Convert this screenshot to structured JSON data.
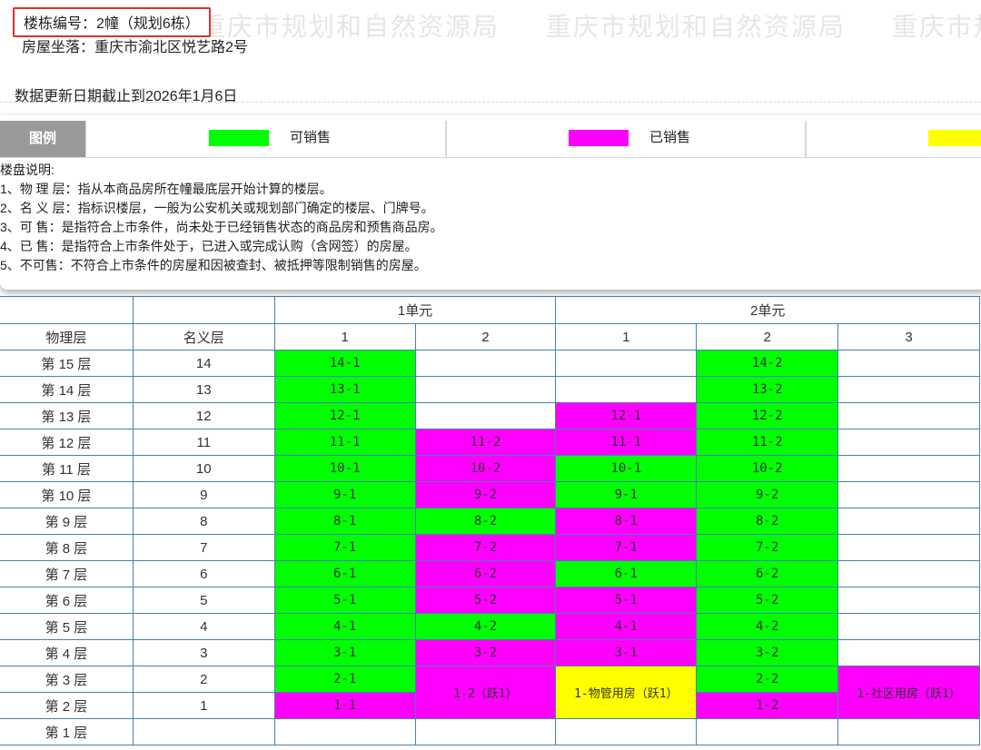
{
  "watermark": [
    "重庆市规划和自然资源局",
    "重庆市规划和自然资源局",
    "重庆市规划和自然资源局"
  ],
  "header": {
    "building_label": "楼栋编号：2幢（规划6栋）",
    "address_label": "房屋坐落：重庆市渝北区悦艺路2号",
    "update_text": "数据更新日期截止到2026年1月6日"
  },
  "legend": {
    "title": "图例",
    "items": [
      {
        "label": "可销售",
        "color": "#00ff00"
      },
      {
        "label": "已销售",
        "color": "#ff00ff"
      },
      {
        "label": "",
        "color": "#ffff00"
      }
    ]
  },
  "notes": {
    "heading": "楼盘说明:",
    "items": [
      "1、物 理 层：指从本商品房所在幢最底层开始计算的楼层。",
      "2、名 义 层：指标识楼层，一般为公安机关或规划部门确定的楼层、门牌号。",
      "3、可 售：是指符合上市条件，尚未处于已经销售状态的商品房和预售商品房。",
      "4、已 售：是指符合上市条件处于，已进入或完成认购（含网签）的房屋。",
      "5、不可售：不符合上市条件的房屋和因被查封、被抵押等限制销售的房屋。"
    ]
  },
  "table": {
    "units": [
      "1单元",
      "2单元"
    ],
    "col_physical": "物理层",
    "col_nominal": "名义层",
    "room_cols": [
      "1",
      "2",
      "1",
      "2",
      "3"
    ],
    "rows": [
      {
        "physical": "第 15 层",
        "nominal": "14",
        "c1": "14-1",
        "c2": "",
        "c3": "",
        "c4": "14-2",
        "c5": ""
      },
      {
        "physical": "第 14 层",
        "nominal": "13",
        "c1": "13-1",
        "c2": "",
        "c3": "",
        "c4": "13-2",
        "c5": ""
      },
      {
        "physical": "第 13 层",
        "nominal": "12",
        "c1": "12-1",
        "c2": "",
        "c3": "12-1",
        "c4": "12-2",
        "c5": ""
      },
      {
        "physical": "第 12 层",
        "nominal": "11",
        "c1": "11-1",
        "c2": "11-2",
        "c3": "11-1",
        "c4": "11-2",
        "c5": ""
      },
      {
        "physical": "第 11 层",
        "nominal": "10",
        "c1": "10-1",
        "c2": "10-2",
        "c3": "10-1",
        "c4": "10-2",
        "c5": ""
      },
      {
        "physical": "第 10 层",
        "nominal": "9",
        "c1": "9-1",
        "c2": "9-2",
        "c3": "9-1",
        "c4": "9-2",
        "c5": ""
      },
      {
        "physical": "第 9 层",
        "nominal": "8",
        "c1": "8-1",
        "c2": "8-2",
        "c3": "8-1",
        "c4": "8-2",
        "c5": ""
      },
      {
        "physical": "第 8 层",
        "nominal": "7",
        "c1": "7-1",
        "c2": "7-2",
        "c3": "7-1",
        "c4": "7-2",
        "c5": ""
      },
      {
        "physical": "第 7 层",
        "nominal": "6",
        "c1": "6-1",
        "c2": "6-2",
        "c3": "6-1",
        "c4": "6-2",
        "c5": ""
      },
      {
        "physical": "第 6 层",
        "nominal": "5",
        "c1": "5-1",
        "c2": "5-2",
        "c3": "5-1",
        "c4": "5-2",
        "c5": ""
      },
      {
        "physical": "第 5 层",
        "nominal": "4",
        "c1": "4-1",
        "c2": "4-2",
        "c3": "4-1",
        "c4": "4-2",
        "c5": ""
      },
      {
        "physical": "第 4 层",
        "nominal": "3",
        "c1": "3-1",
        "c2": "3-2",
        "c3": "3-1",
        "c4": "3-2",
        "c5": ""
      },
      {
        "physical": "第 3 层",
        "nominal": "2",
        "c1": "2-1",
        "c2": "1-2（跃1）",
        "c3": "1-物管用房（跃1）",
        "c4": "2-2",
        "c5": "1-社区用房（跃1）"
      },
      {
        "physical": "第 2 层",
        "nominal": "1",
        "c1": "1-1",
        "c4": "1-2"
      },
      {
        "physical": "第 1 层",
        "nominal": "",
        "c1": "",
        "c2": "",
        "c3": "",
        "c4": "",
        "c5": ""
      }
    ]
  }
}
